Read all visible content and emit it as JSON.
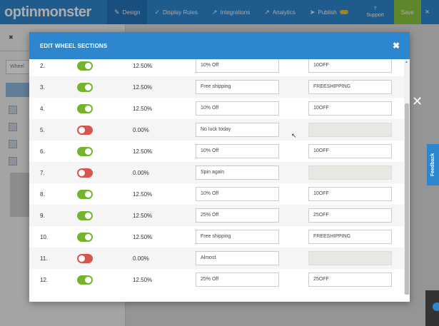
{
  "app": {
    "logo": "optinmonster",
    "nav": [
      {
        "label": "Design",
        "icon": "✎"
      },
      {
        "label": "Display Rules",
        "icon": "✓"
      },
      {
        "label": "Integrations",
        "icon": "↗"
      },
      {
        "label": "Analytics",
        "icon": "↗"
      },
      {
        "label": "Publish",
        "icon": "➤"
      }
    ],
    "publish_badge": "…",
    "support_label": "Support",
    "save_label": "Save",
    "close_glyph": "×",
    "sidebar_field": "Wheel",
    "feedback_label": "Feedback"
  },
  "modal": {
    "title": "EDIT WHEEL SECTIONS",
    "close_glyph": "✖",
    "rows": [
      {
        "num": "2.",
        "enabled": true,
        "percent": "12.50%",
        "label": "10% Off",
        "code": "10OFF"
      },
      {
        "num": "3.",
        "enabled": true,
        "percent": "12.50%",
        "label": "Free shipping",
        "code": "FREESHIPPING"
      },
      {
        "num": "4.",
        "enabled": true,
        "percent": "12.50%",
        "label": "10% Off",
        "code": "10OFF"
      },
      {
        "num": "5.",
        "enabled": false,
        "percent": "0.00%",
        "label": "No luck today",
        "code": ""
      },
      {
        "num": "6.",
        "enabled": true,
        "percent": "12.50%",
        "label": "10% Off",
        "code": "10OFF"
      },
      {
        "num": "7.",
        "enabled": false,
        "percent": "0.00%",
        "label": "Spin again",
        "code": ""
      },
      {
        "num": "8.",
        "enabled": true,
        "percent": "12.50%",
        "label": "10% Off",
        "code": "10OFF"
      },
      {
        "num": "9.",
        "enabled": true,
        "percent": "12.50%",
        "label": "25% Off",
        "code": "25OFF"
      },
      {
        "num": "10.",
        "enabled": true,
        "percent": "12.50%",
        "label": "Free shipping",
        "code": "FREESHIPPING"
      },
      {
        "num": "11.",
        "enabled": false,
        "percent": "0.00%",
        "label": "Almost",
        "code": ""
      },
      {
        "num": "12.",
        "enabled": true,
        "percent": "12.50%",
        "label": "25% Off",
        "code": "25OFF"
      }
    ]
  },
  "colors": {
    "primary": "#2e86cf",
    "toggle_on": "#74b32e",
    "toggle_off": "#d9534f",
    "save": "#8cc63f"
  }
}
